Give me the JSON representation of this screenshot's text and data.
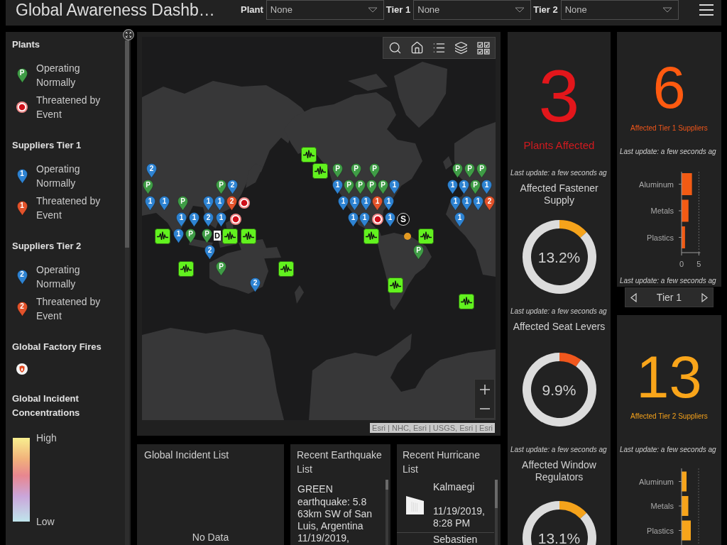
{
  "header": {
    "title": "Global Awareness Dashb…",
    "filters": [
      {
        "label": "Plant",
        "value": "None"
      },
      {
        "label": "Tier 1",
        "value": "None"
      },
      {
        "label": "Tier 2",
        "value": "None"
      }
    ]
  },
  "legend": {
    "sections": [
      {
        "title": "Plants",
        "items": [
          {
            "kind": "plant",
            "symbol": "P",
            "label": "Operating Normally"
          },
          {
            "kind": "plant_threat",
            "label": "Threatened by Event"
          }
        ]
      },
      {
        "title": "Suppliers Tier 1",
        "items": [
          {
            "kind": "supplier",
            "symbol": "1",
            "label": "Operating Normally"
          },
          {
            "kind": "supplier_threat",
            "symbol": "1",
            "label": "Threatened by Event"
          }
        ]
      },
      {
        "title": "Suppliers Tier 2",
        "items": [
          {
            "kind": "supplier",
            "symbol": "2",
            "label": "Operating Normally"
          },
          {
            "kind": "supplier_threat",
            "symbol": "2",
            "label": "Threatened by Event"
          }
        ]
      },
      {
        "title": "Global Factory Fires",
        "items": [
          {
            "kind": "fire"
          }
        ]
      }
    ],
    "ramp": {
      "title": "Global Incident Concentrations",
      "high": "High",
      "low": "Low"
    }
  },
  "map": {
    "markers": [
      {
        "kind": "quake"
      },
      {
        "kind": "supplier",
        "symbol": "2"
      },
      {
        "kind": "quake"
      },
      {
        "kind": "plant",
        "symbol": "P"
      },
      {
        "kind": "plant",
        "symbol": "P"
      },
      {
        "kind": "plant",
        "symbol": "P"
      },
      {
        "kind": "plant",
        "symbol": "P"
      },
      {
        "kind": "plant",
        "symbol": "P"
      },
      {
        "kind": "plant",
        "symbol": "P"
      },
      {
        "kind": "plant",
        "symbol": "P"
      },
      {
        "kind": "plant",
        "symbol": "P"
      },
      {
        "kind": "supplier",
        "symbol": "2"
      },
      {
        "kind": "supplier",
        "symbol": "1"
      },
      {
        "kind": "plant",
        "symbol": "P"
      },
      {
        "kind": "plant",
        "symbol": "P"
      },
      {
        "kind": "plant",
        "symbol": "P"
      },
      {
        "kind": "plant",
        "symbol": "P"
      },
      {
        "kind": "supplier",
        "symbol": "1"
      },
      {
        "kind": "supplier",
        "symbol": "1"
      },
      {
        "kind": "supplier",
        "symbol": "1"
      },
      {
        "kind": "plant",
        "symbol": "P"
      },
      {
        "kind": "supplier",
        "symbol": "1"
      },
      {
        "kind": "supplier",
        "symbol": "1"
      },
      {
        "kind": "supplier",
        "symbol": "1"
      },
      {
        "kind": "plant",
        "symbol": "P"
      },
      {
        "kind": "supplier",
        "symbol": "1"
      },
      {
        "kind": "supplier",
        "symbol": "1"
      },
      {
        "kind": "supplier_threat",
        "symbol": "2"
      },
      {
        "kind": "plant_threat"
      },
      {
        "kind": "supplier",
        "symbol": "1"
      },
      {
        "kind": "supplier",
        "symbol": "1"
      },
      {
        "kind": "supplier",
        "symbol": "1"
      },
      {
        "kind": "supplier_threat",
        "symbol": "1"
      },
      {
        "kind": "supplier",
        "symbol": "1"
      },
      {
        "kind": "supplier",
        "symbol": "1"
      },
      {
        "kind": "supplier",
        "symbol": "1"
      },
      {
        "kind": "supplier",
        "symbol": "1"
      },
      {
        "kind": "supplier_threat",
        "symbol": "2"
      },
      {
        "kind": "supplier",
        "symbol": "1"
      },
      {
        "kind": "supplier",
        "symbol": "1"
      },
      {
        "kind": "supplier",
        "symbol": "2"
      },
      {
        "kind": "supplier",
        "symbol": "1"
      },
      {
        "kind": "plant_threat"
      },
      {
        "kind": "supplier",
        "symbol": "1"
      },
      {
        "kind": "supplier",
        "symbol": "1"
      },
      {
        "kind": "plant_threat"
      },
      {
        "kind": "supplier",
        "symbol": "1"
      },
      {
        "kind": "hurricane",
        "symbol": "S"
      },
      {
        "kind": "supplier",
        "symbol": "1"
      },
      {
        "kind": "quake"
      },
      {
        "kind": "supplier",
        "symbol": "1"
      },
      {
        "kind": "plant",
        "symbol": "P"
      },
      {
        "kind": "plant",
        "symbol": "P"
      },
      {
        "kind": "tag",
        "symbol": "D"
      },
      {
        "kind": "quake"
      },
      {
        "kind": "quake"
      },
      {
        "kind": "quake"
      },
      {
        "kind": "track"
      },
      {
        "kind": "quake"
      },
      {
        "kind": "supplier",
        "symbol": "2"
      },
      {
        "kind": "plant",
        "symbol": "P"
      },
      {
        "kind": "quake"
      },
      {
        "kind": "plant",
        "symbol": "P"
      },
      {
        "kind": "quake"
      },
      {
        "kind": "supplier",
        "symbol": "2"
      },
      {
        "kind": "quake"
      },
      {
        "kind": "quake"
      }
    ],
    "attribution": "Esri | NHC, Esri | USGS, Esri | Esri"
  },
  "lists": [
    {
      "kind": "incident",
      "title": "Global Incident List",
      "empty_text": "No Data"
    },
    {
      "kind": "earthquake",
      "title": "Recent Earthquake List",
      "items": [
        {
          "alert": "GREEN",
          "description": "earthquake: 5.8 63km SW of San Luis, Argentina",
          "date": "11/19/2019,"
        }
      ]
    },
    {
      "kind": "hurricane",
      "title": "Recent Hurricane List",
      "items": [
        {
          "name": "Kalmaegi",
          "date": "11/19/2019,",
          "time": "8:28 PM"
        },
        {
          "name": "Sebastien"
        }
      ]
    }
  ],
  "impact_column": {
    "indicator": {
      "value": "3",
      "caption": "Plants Affected",
      "updated": "Last update: a few seconds ag"
    },
    "gauges": [
      {
        "title": "Affected Fastener Supply",
        "reading": "13.2%",
        "color": "#f5a31b",
        "chart_data": {
          "type": "donut",
          "values": [
            13.2,
            86.8
          ]
        },
        "updated": "Last update: a few seconds ag"
      },
      {
        "title": "Affected Seat Levers",
        "reading": "9.9%",
        "color": "#f0571d",
        "chart_data": {
          "type": "donut",
          "values": [
            9.9,
            90.1
          ]
        },
        "updated": "Last update: a few seconds ag"
      },
      {
        "title": "Affected Window Regulators",
        "reading": "13.1%",
        "color": "#f5a31b",
        "chart_data": {
          "type": "donut",
          "values": [
            13.1,
            86.9
          ]
        }
      }
    ]
  },
  "supplier_column": {
    "tier1": {
      "value": "6",
      "caption": "Affected Tier 1 Suppliers",
      "updated": "Last update: a few seconds ag",
      "chart_data": {
        "type": "bar",
        "orientation": "horizontal",
        "categories": [
          "Aluminum",
          "Metals",
          "Plastics"
        ],
        "values": [
          3,
          2,
          1
        ],
        "xticks": [
          0,
          5
        ],
        "xlim": [
          0,
          5
        ]
      },
      "chart_updated": "Last update: a few seconds ag"
    },
    "pager": {
      "label": "Tier 1"
    },
    "tier2": {
      "value": "13",
      "caption": "Affected Tier 2 Suppliers",
      "updated": "Last update: a few seconds ag",
      "bar_labels": [
        "Aluminum",
        "Metals",
        "Plastics"
      ]
    }
  }
}
